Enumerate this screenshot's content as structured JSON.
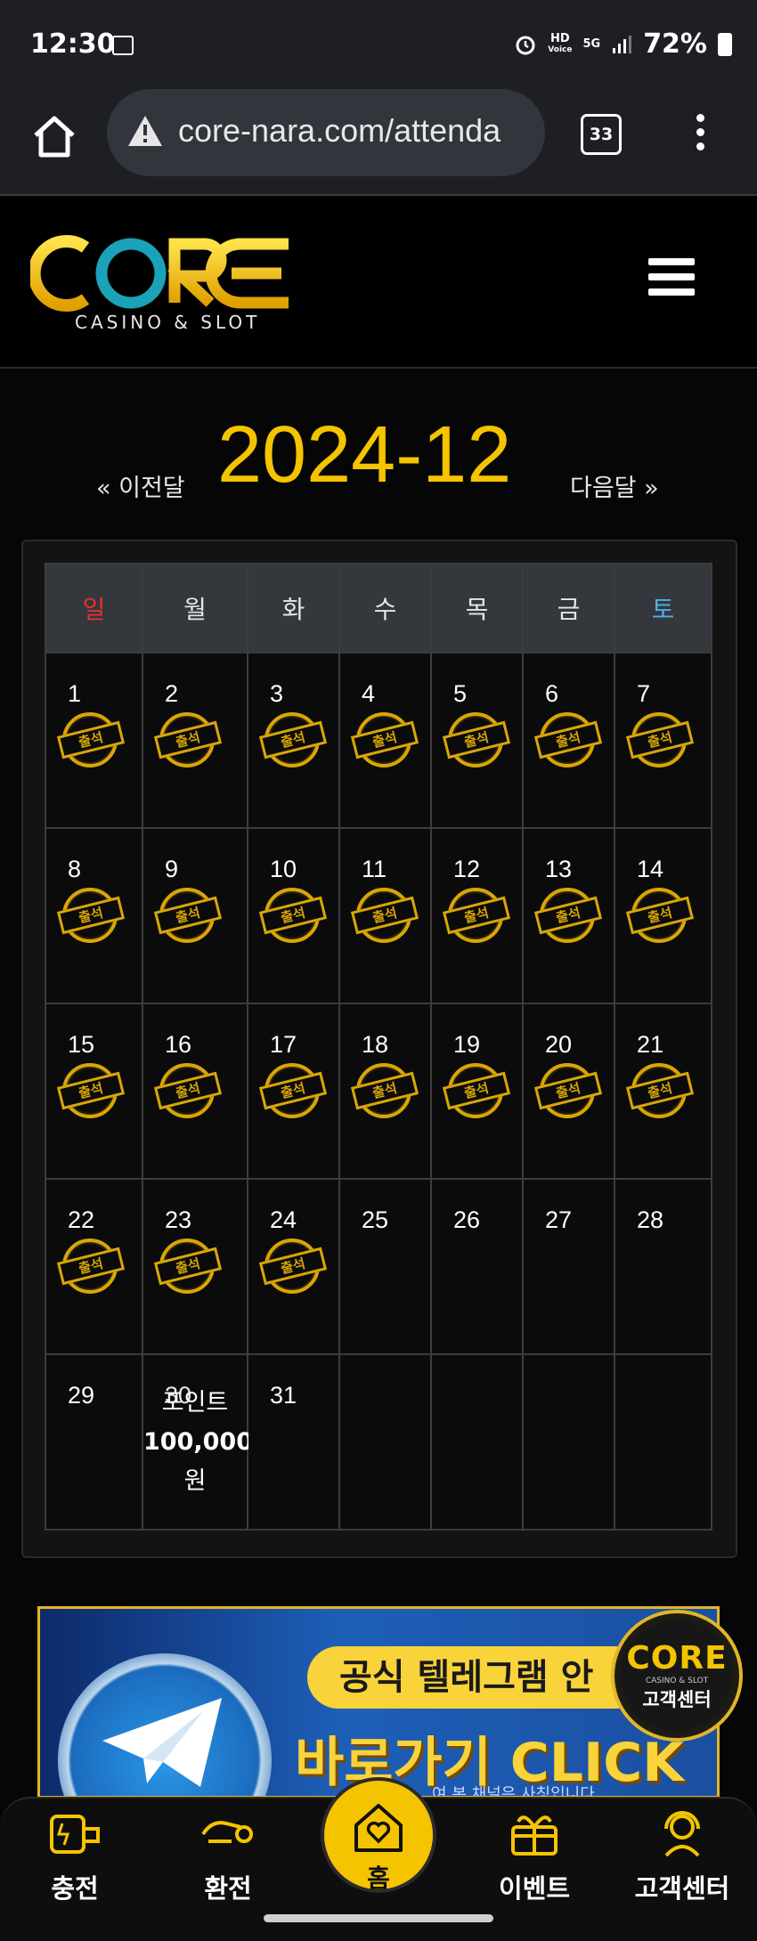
{
  "status_bar": {
    "time": "12:30",
    "hd": "HD",
    "voice": "Voice",
    "network": "5G",
    "battery": "72%"
  },
  "browser": {
    "url": "core-nara.com/attenda",
    "tab_count": "33"
  },
  "site": {
    "logo_text": "CORE",
    "logo_subtitle": "CASINO & SLOT"
  },
  "month_nav": {
    "prev": "« 이전달",
    "title": "2024-12",
    "next": "다음달 »"
  },
  "calendar": {
    "weekdays": [
      "일",
      "월",
      "화",
      "수",
      "목",
      "금",
      "토"
    ],
    "stamp_label": "출석",
    "weeks": [
      [
        "1",
        "2",
        "3",
        "4",
        "5",
        "6",
        "7"
      ],
      [
        "8",
        "9",
        "10",
        "11",
        "12",
        "13",
        "14"
      ],
      [
        "15",
        "16",
        "17",
        "18",
        "19",
        "20",
        "21"
      ],
      [
        "22",
        "23",
        "24",
        "25",
        "26",
        "27",
        "28"
      ],
      [
        "29",
        "30",
        "31",
        "",
        "",
        "",
        ""
      ]
    ],
    "attended_through": 24,
    "point_reward": {
      "day": "30",
      "label": "포인트",
      "amount": "100,000",
      "unit": "원"
    }
  },
  "banner": {
    "line1": "공식 텔레그램 안",
    "line2": "바로가기 CLICK",
    "line3": "여 본 채널은 사칭입니다"
  },
  "badge": {
    "logo": "CORE",
    "sub": "CASINO & SLOT",
    "label": "고객센터"
  },
  "bottom_nav": {
    "charge": "충전",
    "exchange": "환전",
    "home": "홈",
    "event": "이벤트",
    "support": "고객센터"
  },
  "colors": {
    "accent": "#f5c400",
    "sunday": "#e83030",
    "saturday": "#4eb0ea"
  }
}
